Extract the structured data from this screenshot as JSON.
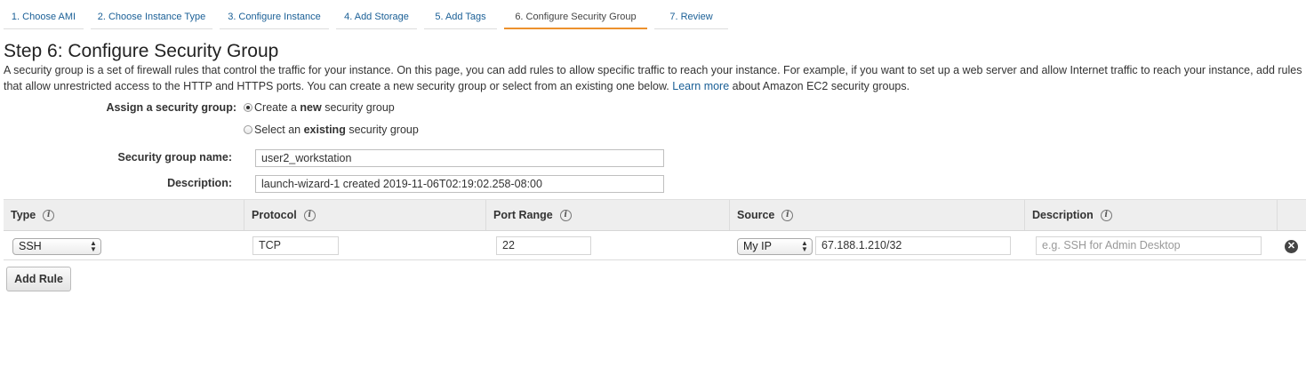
{
  "wizard": {
    "tabs": [
      {
        "label": "1. Choose AMI"
      },
      {
        "label": "2. Choose Instance Type"
      },
      {
        "label": "3. Configure Instance"
      },
      {
        "label": "4. Add Storage"
      },
      {
        "label": "5. Add Tags"
      },
      {
        "label": "6. Configure Security Group",
        "active": true
      },
      {
        "label": "7. Review"
      }
    ]
  },
  "page": {
    "title": "Step 6: Configure Security Group",
    "intro": "A security group is a set of firewall rules that control the traffic for your instance. On this page, you can add rules to allow specific traffic to reach your instance. For example, if you want to set up a web server and allow Internet traffic to reach your instance, add rules that allow unrestricted access to the HTTP and HTTPS ports. You can create a new security group or select from an existing one below.",
    "learn_more": "Learn more",
    "intro_tail": "about Amazon EC2 security groups."
  },
  "assign": {
    "label": "Assign a security group:",
    "option_new": {
      "prefix": "Create a ",
      "bold": "new",
      "suffix": " security group",
      "selected": true
    },
    "option_existing": {
      "prefix": "Select an ",
      "bold": "existing",
      "suffix": " security group",
      "selected": false
    }
  },
  "group_name": {
    "label": "Security group name:",
    "value": "user2_workstation"
  },
  "description": {
    "label": "Description:",
    "value": "launch-wizard-1 created 2019-11-06T02:19:02.258-08:00"
  },
  "table": {
    "headers": {
      "type": "Type",
      "protocol": "Protocol",
      "port_range": "Port Range",
      "source": "Source",
      "description": "Description"
    },
    "info_glyph": "i",
    "rows": [
      {
        "type": "SSH",
        "protocol": "TCP",
        "port_range": "22",
        "source_select": "My IP",
        "source_value": "67.188.1.210/32",
        "description_placeholder": "e.g. SSH for Admin Desktop"
      }
    ]
  },
  "buttons": {
    "add_rule": "Add Rule",
    "remove_glyph": "✕"
  },
  "colors": {
    "active_tab": "#ec912d",
    "link": "#1a5f96"
  }
}
